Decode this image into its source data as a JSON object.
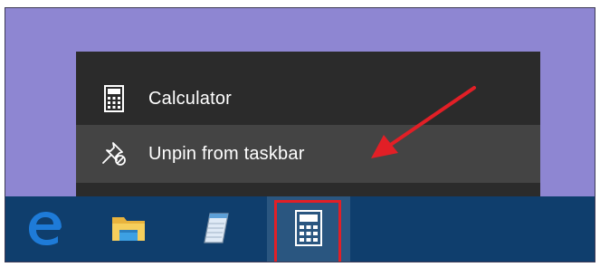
{
  "jump_list": {
    "app_item": {
      "label": "Calculator",
      "icon": "calculator-icon"
    },
    "unpin_item": {
      "label": "Unpin from taskbar",
      "icon": "unpin-icon"
    }
  },
  "taskbar": {
    "apps": [
      {
        "name": "Microsoft Edge",
        "icon": "edge-icon"
      },
      {
        "name": "File Explorer",
        "icon": "folder-icon"
      },
      {
        "name": "Notepad",
        "icon": "notepad-icon"
      },
      {
        "name": "Calculator",
        "icon": "calculator-icon"
      }
    ]
  },
  "annotation": {
    "arrow_color": "#e21f26",
    "highlight_color": "#e21f26"
  },
  "colors": {
    "desktop": "#8e86d2",
    "jump_list_bg": "#2b2b2b",
    "hover_bg": "#444444",
    "taskbar_bg": "#0f3e6d",
    "active_app_bg": "#2a5680",
    "edge_blue": "#1e7bd8"
  }
}
